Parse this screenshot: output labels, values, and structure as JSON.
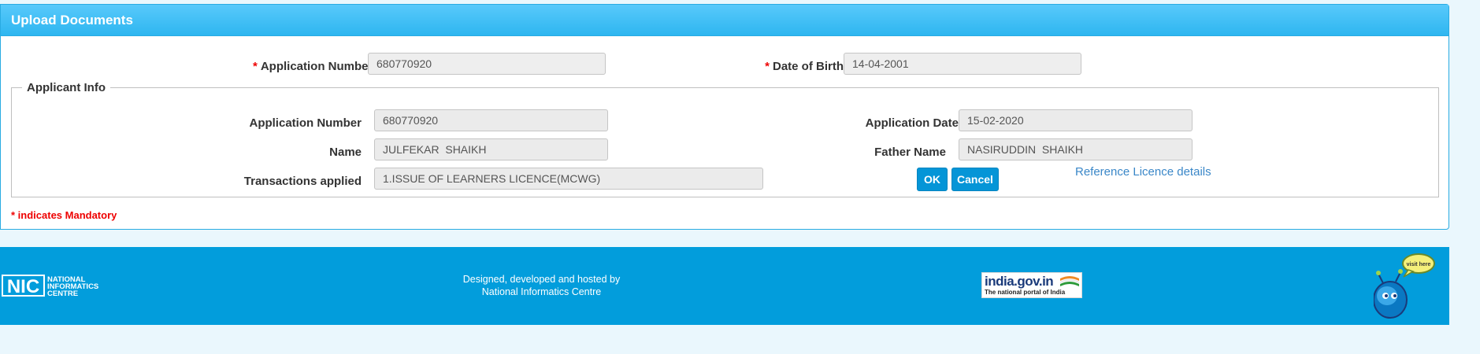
{
  "panel": {
    "title": "Upload Documents"
  },
  "search": {
    "application_number_label": "Application Number",
    "application_number_value": "680770920",
    "dob_label": "Date of Birth",
    "dob_value": "14-04-2001",
    "required_marker": "*"
  },
  "applicant_info": {
    "legend": "Applicant Info",
    "application_number_label": "Application Number",
    "application_number_value": "680770920",
    "application_date_label": "Application Date",
    "application_date_value": "15-02-2020",
    "name_label": "Name",
    "name_value": "JULFEKAR  SHAIKH",
    "father_name_label": "Father Name",
    "father_name_value": "NASIRUDDIN  SHAIKH",
    "transactions_label": "Transactions applied",
    "transactions_value": "1.ISSUE OF LEARNERS LICENCE(MCWG)",
    "ok_label": "OK",
    "cancel_label": "Cancel",
    "reference_link": "Reference Licence details"
  },
  "mandatory_note": "* indicates Mandatory",
  "footer": {
    "nic_logo_text": "NIC",
    "nic_name_line1": "NATIONAL",
    "nic_name_line2": "INFORMATICS",
    "nic_name_line3": "CENTRE",
    "designed_line1": "Designed, developed and hosted by",
    "designed_line2": "National Informatics Centre",
    "india_gov_title": "india.gov.in",
    "india_gov_tagline": "The national portal of India",
    "mascot_bubble": "visit here"
  },
  "colors": {
    "accent": "#029ddc",
    "header": "#2eb6f0",
    "button": "#0595d7",
    "required": "#ee0000",
    "link": "#3a87c8"
  }
}
